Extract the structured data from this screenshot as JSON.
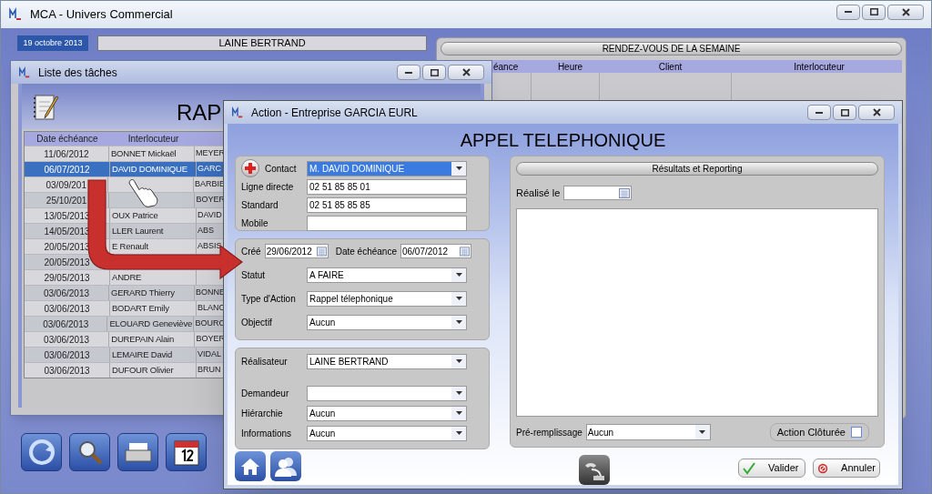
{
  "window": {
    "title": "MCA - Univers Commercial"
  },
  "header": {
    "date": "19 octobre 2013",
    "user": "LAINE BERTRAND"
  },
  "appointments": {
    "title": "RENDEZ-VOUS DE LA SEMAINE",
    "columns": [
      "éance",
      "Heure",
      "Client",
      "Interlocuteur"
    ]
  },
  "task_list": {
    "title": "Liste des tâches",
    "heading": "RAP",
    "columns": [
      "Date échéance",
      "Interlocuteur"
    ],
    "rows": [
      {
        "date": "11/06/2012",
        "contact": "BONNET Mickaël",
        "column_3": "MEYER",
        "selected": false
      },
      {
        "date": "06/07/2012",
        "contact": "DAVID DOMINIQUE",
        "column_3": "GARC",
        "selected": true
      },
      {
        "date": "03/09/201",
        "contact": "",
        "column_3": "BARBIE",
        "selected": false
      },
      {
        "date": "25/10/201",
        "contact": "",
        "column_3": "BOYER",
        "selected": false
      },
      {
        "date": "13/05/2013",
        "contact": "OUX Patrice",
        "column_3": "DAVID",
        "selected": false
      },
      {
        "date": "14/05/2013",
        "contact": "LLER Laurent",
        "column_3": "ABS",
        "selected": false
      },
      {
        "date": "20/05/2013",
        "contact": "E Renault",
        "column_3": "ABSIS",
        "selected": false
      },
      {
        "date": "20/05/2013",
        "contact": "",
        "column_3": "",
        "selected": false
      },
      {
        "date": "29/05/2013",
        "contact": "ANDRE",
        "column_3": "",
        "selected": false
      },
      {
        "date": "03/06/2013",
        "contact": "GERARD Thierry",
        "column_3": "BONNE",
        "selected": false
      },
      {
        "date": "03/06/2013",
        "contact": "BODART Emily",
        "column_3": "BLANC",
        "selected": false
      },
      {
        "date": "03/06/2013",
        "contact": "ELOUARD Geneviève",
        "column_3": "BOURC",
        "selected": false
      },
      {
        "date": "03/06/2013",
        "contact": "DUREPAIN Alain",
        "column_3": "BOYER",
        "selected": false
      },
      {
        "date": "03/06/2013",
        "contact": "LEMAIRE David",
        "column_3": "VIDAL",
        "selected": false
      },
      {
        "date": "03/06/2013",
        "contact": "DUFOUR Olivier",
        "column_3": "BRUN",
        "selected": false
      }
    ]
  },
  "action": {
    "title": "Action - Entreprise GARCIA EURL",
    "heading": "APPEL TELEPHONIQUE",
    "contact_section": {
      "rows": [
        {
          "kind": "combo",
          "label": "Contact",
          "value": "M. DAVID DOMINIQUE",
          "focused": true
        },
        {
          "kind": "text",
          "label": "Ligne directe",
          "value": "02 51 85 85 01"
        },
        {
          "kind": "text",
          "label": "Standard",
          "value": "02 51 85 85 85"
        },
        {
          "kind": "text",
          "label": "Mobile",
          "value": ""
        }
      ]
    },
    "dates": [
      {
        "label": "Créé",
        "value": "29/06/2012"
      },
      {
        "label": "Date échéance",
        "value": "06/07/2012"
      }
    ],
    "status_section": {
      "rows": [
        {
          "kind": "combo",
          "label": "Statut",
          "value": "A FAIRE",
          "focused": false
        },
        {
          "kind": "combo",
          "label": "Type d'Action",
          "value": "Rappel télephonique",
          "focused": false
        },
        {
          "kind": "combo",
          "label": "Objectif",
          "value": "Aucun",
          "focused": false
        }
      ]
    },
    "people_section": {
      "rows": [
        {
          "kind": "combo",
          "label": "Réalisateur",
          "value": "LAINE BERTRAND",
          "focused": false
        },
        {
          "kind": "combo",
          "label": "Demandeur",
          "value": "",
          "focused": false
        },
        {
          "kind": "combo",
          "label": "Hiérarchie",
          "value": "Aucun",
          "focused": false
        },
        {
          "kind": "combo",
          "label": "Informations",
          "value": "Aucun",
          "focused": false
        }
      ]
    },
    "results": {
      "title": "Résultats et Reporting",
      "done_label": "Réalisé le",
      "prefill_label": "Pré-remplissage",
      "prefill_value": "Aucun",
      "closed": {
        "label": "Action Clôturée",
        "checked": false
      }
    },
    "buttons": [
      {
        "kind": "ok",
        "label": "Valider"
      },
      {
        "kind": "cancel",
        "label": "Annuler"
      }
    ]
  }
}
